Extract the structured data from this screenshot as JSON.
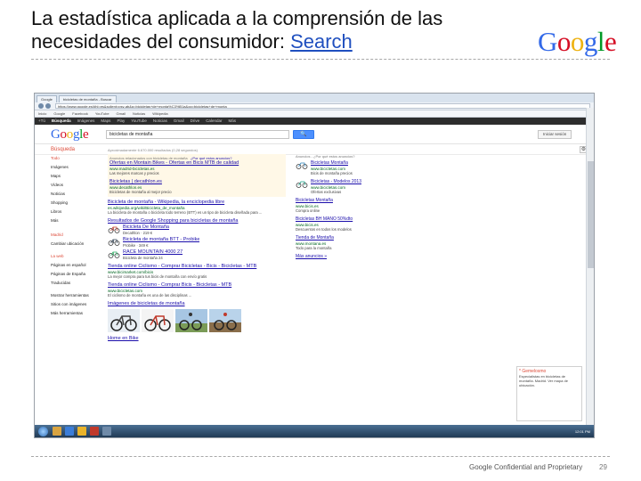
{
  "slide": {
    "title": "La estadística aplicada a la comprensión de las necesidades del consumidor: ",
    "title_link": "Search",
    "logo": "Google",
    "footer": "Google Confidential and Proprietary",
    "page_number": "29"
  },
  "browser": {
    "tabs": [
      "Google",
      "bicicletas de montaña - Buscar"
    ],
    "url": "https://www.google.es/#hl=es&sclient=psy-ab&q=bicicletas+de+monta%C3%B1a&oq=bicicletas+de+monta",
    "bookmarks": [
      "Inicio",
      "Google",
      "Facebook",
      "YouTube",
      "Gmail",
      "Noticias",
      "Wikipedia"
    ],
    "gbar": [
      "+Tú",
      "Búsqueda",
      "Imágenes",
      "Maps",
      "Play",
      "YouTube",
      "Noticias",
      "Gmail",
      "Drive",
      "Calendar",
      "Más"
    ]
  },
  "serp": {
    "logo": "Google",
    "query": "bicicletas de montaña",
    "search_button": "🔍",
    "signin": "Iniciar sesión",
    "busqueda_label": "Búsqueda",
    "results_count": "Aproximadamente 6.670.000 resultados (0,28 segundos)",
    "left_nav": [
      "Todo",
      "Imágenes",
      "Maps",
      "Vídeos",
      "Noticias",
      "Shopping",
      "Libros",
      "Más"
    ],
    "left_location_label": "Madrid",
    "left_location_action": "Cambiar ubicación",
    "left_filters": [
      "La web",
      "Páginas en español",
      "Páginas de España",
      "Traducidas"
    ],
    "left_tools": [
      "Mostrar herramientas",
      "Sitios con imágenes",
      "Más herramientas"
    ],
    "ads_label": "Anuncios relacionados con bicicletas de montaña",
    "ads_link": "¿Por qué estos anuncios?",
    "ads": [
      {
        "title": "Ofertas en Montain Bikes - Ofertas en Bicis MTB de calidad",
        "url": "www.madrid-bicicletas.es",
        "snippet": "Las mejores marcas y precios"
      },
      {
        "title": "Bicicletas | decathlon.es",
        "url": "www.decathlon.es",
        "snippet": "Bicicletas de montaña al mejor precio"
      }
    ],
    "organic": [
      {
        "title": "Bicicleta de montaña - Wikipedia, la enciclopedia libre",
        "url": "es.wikipedia.org/wiki/Bicicleta_de_montaña",
        "snippet": "La bicicleta de montaña o bicicleta todo terreno (BTT) es un tipo de bicicleta diseñada para ..."
      },
      {
        "title": "Resultados de Google Shopping para bicicletas de montaña",
        "url": "",
        "snippet": ""
      }
    ],
    "shopping": [
      {
        "title": "Bicicleta De Montaña",
        "snippet": "Decathlon · 219 €"
      },
      {
        "title": "Bicicleta de montaña BTT - Probike",
        "snippet": "Probike · 349 €"
      },
      {
        "title": "RACE MOUNTAIN 4000 27",
        "snippet": "Bicicleta de montaña 24"
      }
    ],
    "more_results": [
      {
        "title": "Tienda online Ciclismo - Comprar Bicicletas - Bicis - Bicicletas - MTB",
        "url": "www.bicimarket.com/bicis",
        "snippet": "La mejor compra para tus bicis de montaña con envío gratis"
      },
      {
        "title": "Tienda online Ciclismo - Comprar Bicis - Bicicletas - MTB",
        "url": "www.bicicletas.com",
        "snippet": "El ciclismo de montaña es una de las disciplinas ..."
      }
    ],
    "images_title": "Imágenes de bicicletas de montaña",
    "images_footer": "Home en Bike",
    "right_header": "Anuncios - ¿Por qué estos anuncios?",
    "right_ads": [
      {
        "title": "Bicicletas Montaña",
        "url": "www.bicicletas.com",
        "snippet": "Bicis de montaña precios"
      },
      {
        "title": "Bicicletas - Modelos 2013",
        "url": "www.bicicletas.com",
        "snippet": "Ofertas exclusivas"
      },
      {
        "title": "Bicicletas Montaña",
        "url": "www.bicis.es",
        "snippet": "Compra online"
      },
      {
        "title": "Bicicletas BH MANO 50%dto",
        "url": "www.bicis.es",
        "snippet": "Descuentos en todos los modelos"
      },
      {
        "title": "Tienda de Montaña",
        "url": "www.montana.es",
        "snippet": "Todo para la montaña"
      }
    ],
    "right_more": "Más anuncios »",
    "card_title": "* Gemelosmo",
    "card_body": "Especialistas en bicicletas de montaña. Madrid. Ver mapa de ubicación.",
    "clock": "12:01 PM"
  }
}
